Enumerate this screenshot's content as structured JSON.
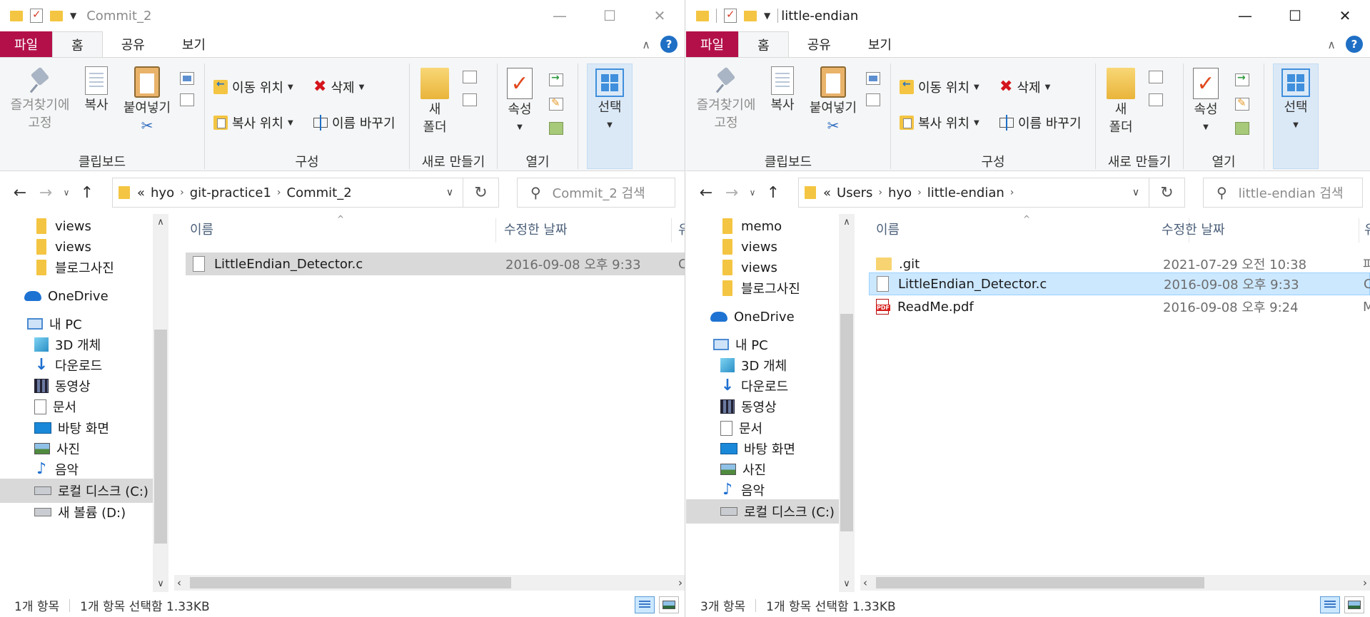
{
  "windows": {
    "left": {
      "title": "Commit_2",
      "tabs": [
        "파일",
        "홈",
        "공유",
        "보기"
      ],
      "ribbon": {
        "pin_line1": "즐겨찾기에",
        "pin_line2": "고정",
        "copy": "복사",
        "paste": "붙여넣기",
        "clipboard_group": "클립보드",
        "move_to": "이동 위치",
        "copy_to": "복사 위치",
        "delete": "삭제",
        "rename": "이름 바꾸기",
        "organize_group": "구성",
        "new_folder_line1": "새",
        "new_folder_line2": "폴더",
        "new_group": "새로 만들기",
        "properties": "속성",
        "open_group": "열기",
        "select": "선택"
      },
      "address": {
        "overflow": "«",
        "crumbs": [
          "hyo",
          "git-practice1",
          "Commit_2"
        ],
        "search_placeholder": "Commit_2 검색"
      },
      "nav": [
        {
          "label": "views",
          "icon": "folder-icon"
        },
        {
          "label": "views",
          "icon": "folder-icon"
        },
        {
          "label": "블로그사진",
          "icon": "folder-icon"
        },
        {
          "label": "OneDrive",
          "icon": "onedrive-icon"
        },
        {
          "label": "내 PC",
          "icon": "pc-icon"
        },
        {
          "label": "3D 개체",
          "icon": "3d-objects-icon"
        },
        {
          "label": "다운로드",
          "icon": "download-icon"
        },
        {
          "label": "동영상",
          "icon": "video-icon"
        },
        {
          "label": "문서",
          "icon": "documents-icon"
        },
        {
          "label": "바탕 화면",
          "icon": "desktop-icon"
        },
        {
          "label": "사진",
          "icon": "pictures-icon"
        },
        {
          "label": "음악",
          "icon": "music-icon"
        },
        {
          "label": "로컬 디스크 (C:)",
          "icon": "disk-icon"
        },
        {
          "label": "새 볼륨 (D:)",
          "icon": "disk-icon"
        }
      ],
      "columns": {
        "name": "이름",
        "modified": "수정한 날짜",
        "type_partial": "유"
      },
      "files": [
        {
          "name": "LittleEndian_Detector.c",
          "modified": "2016-09-08 오후 9:33",
          "extra": "C",
          "icon": "c-file-icon"
        }
      ],
      "status": {
        "count": "1개 항목",
        "selected": "1개 항목 선택함 1.33KB"
      }
    },
    "right": {
      "title": "little-endian",
      "tabs": [
        "파일",
        "홈",
        "공유",
        "보기"
      ],
      "ribbon": {
        "pin_line1": "즐겨찾기에",
        "pin_line2": "고정",
        "copy": "복사",
        "paste": "붙여넣기",
        "clipboard_group": "클립보드",
        "move_to": "이동 위치",
        "copy_to": "복사 위치",
        "delete": "삭제",
        "rename": "이름 바꾸기",
        "organize_group": "구성",
        "new_folder_line1": "새",
        "new_folder_line2": "폴더",
        "new_group": "새로 만들기",
        "properties": "속성",
        "open_group": "열기",
        "select": "선택"
      },
      "address": {
        "overflow": "«",
        "crumbs": [
          "Users",
          "hyo",
          "little-endian"
        ],
        "search_placeholder": "little-endian 검색"
      },
      "nav": [
        {
          "label": "memo",
          "icon": "folder-icon"
        },
        {
          "label": "views",
          "icon": "folder-icon"
        },
        {
          "label": "views",
          "icon": "folder-icon"
        },
        {
          "label": "블로그사진",
          "icon": "folder-icon"
        },
        {
          "label": "OneDrive",
          "icon": "onedrive-icon"
        },
        {
          "label": "내 PC",
          "icon": "pc-icon"
        },
        {
          "label": "3D 개체",
          "icon": "3d-objects-icon"
        },
        {
          "label": "다운로드",
          "icon": "download-icon"
        },
        {
          "label": "동영상",
          "icon": "video-icon"
        },
        {
          "label": "문서",
          "icon": "documents-icon"
        },
        {
          "label": "바탕 화면",
          "icon": "desktop-icon"
        },
        {
          "label": "사진",
          "icon": "pictures-icon"
        },
        {
          "label": "음악",
          "icon": "music-icon"
        },
        {
          "label": "로컬 디스크 (C:)",
          "icon": "disk-icon"
        }
      ],
      "columns": {
        "name": "이름",
        "modified": "수정한 날짜",
        "type_partial": "유"
      },
      "files": [
        {
          "name": ".git",
          "modified": "2021-07-29 오전 10:38",
          "extra": "파",
          "icon": "folder-icon"
        },
        {
          "name": "LittleEndian_Detector.c",
          "modified": "2016-09-08 오후 9:33",
          "extra": "C",
          "icon": "c-file-icon"
        },
        {
          "name": "ReadMe.pdf",
          "modified": "2016-09-08 오후 9:24",
          "extra": "M",
          "icon": "pdf-icon"
        }
      ],
      "status": {
        "count": "3개 항목",
        "selected": "1개 항목 선택함 1.33KB"
      }
    }
  },
  "colors": {
    "file_tab": "#b3104a",
    "selection_blue": "#cce8ff",
    "selection_gray": "#d9d9d9",
    "help": "#1f6fc5"
  },
  "window_controls": {
    "minimize": "—",
    "maximize": "☐",
    "close": "✕"
  }
}
